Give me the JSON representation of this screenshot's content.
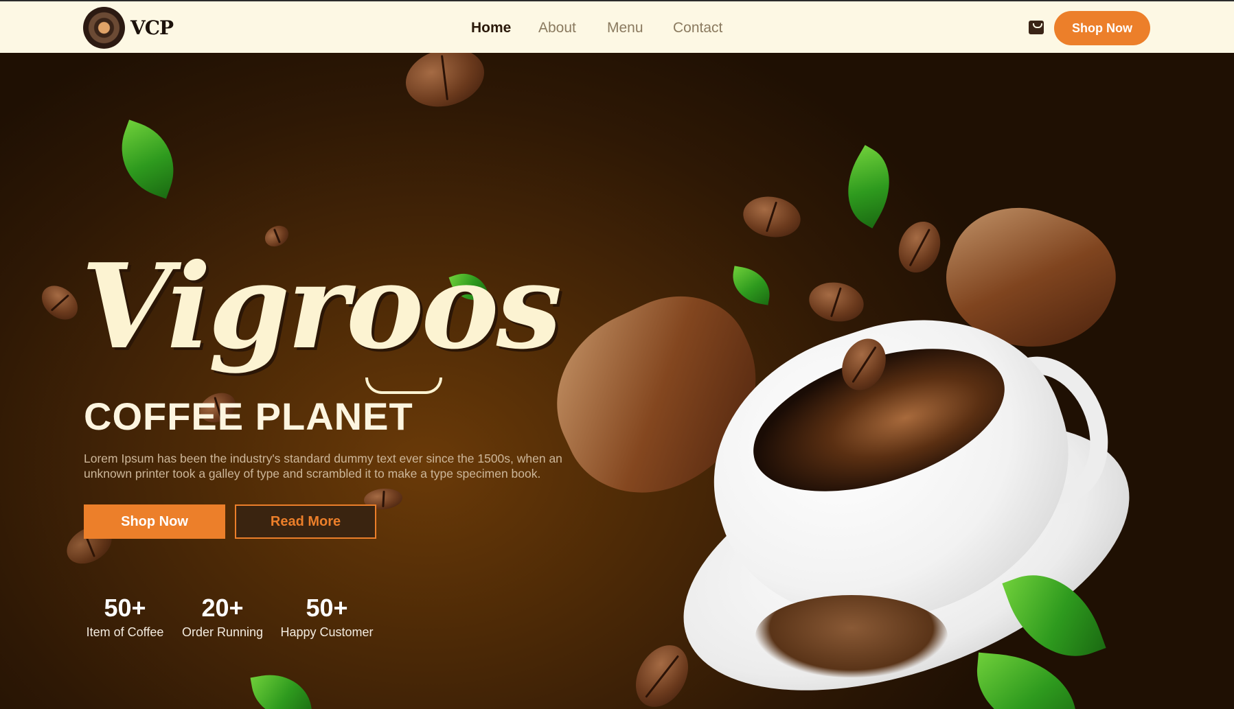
{
  "nav": {
    "logo_text": "VCP",
    "links": [
      {
        "label": "Home",
        "active": true
      },
      {
        "label": "About",
        "active": false
      },
      {
        "label": "Menu",
        "active": false
      },
      {
        "label": "Contact",
        "active": false
      }
    ],
    "shop_button": "Shop Now"
  },
  "hero": {
    "title": "Vigroos",
    "subtitle": "COFFEE PLANET",
    "description": "Lorem Ipsum has been the industry's standard dummy text ever since the 1500s, when an unknown printer took a galley of type and scrambled it to make a type specimen book.",
    "shop_button": "Shop Now",
    "read_more_button": "Read More",
    "stats": [
      {
        "value": "50+",
        "label": "Item of Coffee"
      },
      {
        "value": "20+",
        "label": "Order Running"
      },
      {
        "value": "50+",
        "label": "Happy Customer"
      }
    ]
  },
  "colors": {
    "accent": "#ec7f2a",
    "nav_bg": "#fdf8e4",
    "hero_bg": "#2e1805",
    "title": "#fcf3d2"
  },
  "icons": {
    "cart": "shopping-bag-icon",
    "logo": "coffee-cup-logo-icon"
  }
}
